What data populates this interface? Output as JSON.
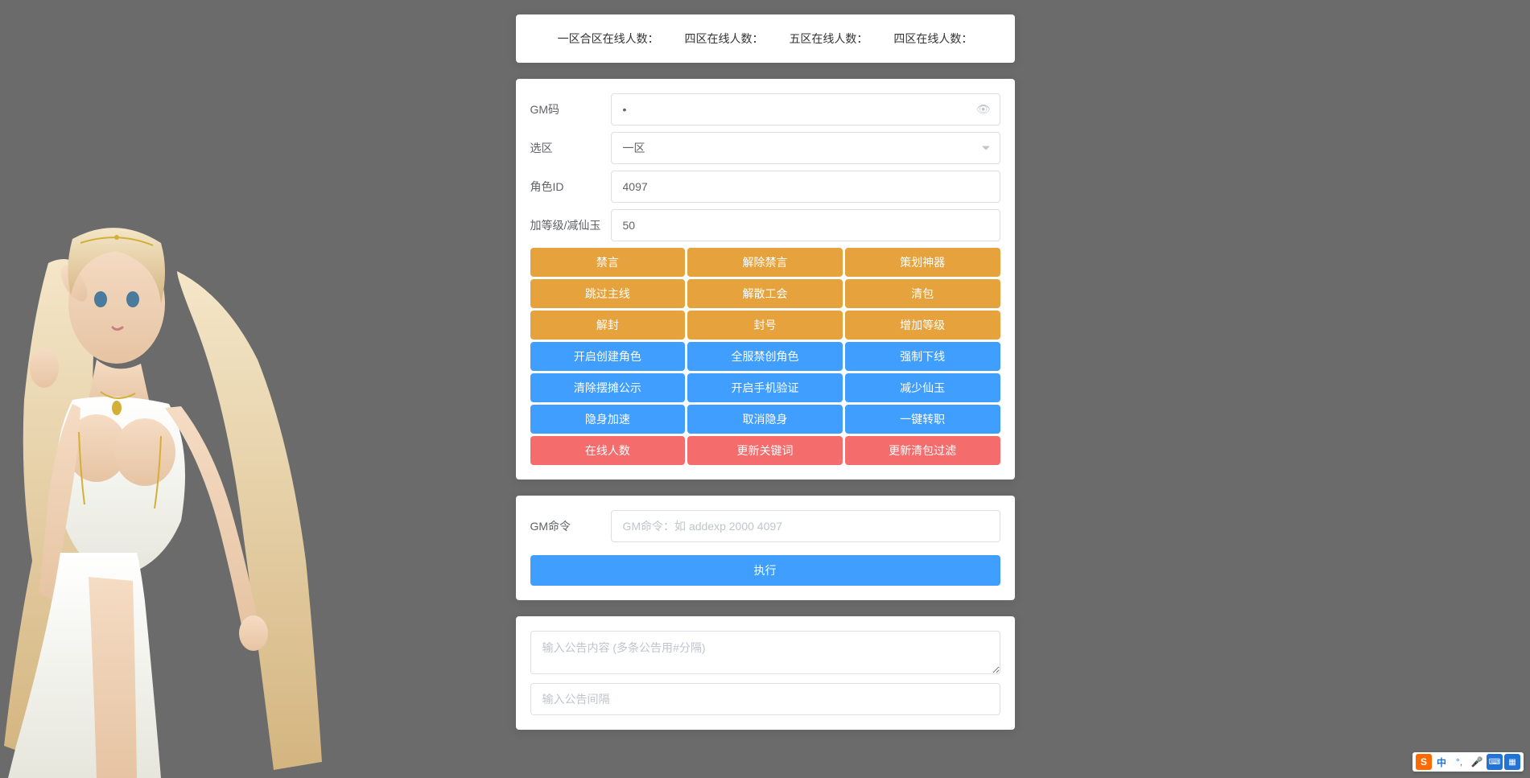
{
  "status": {
    "zone1": "一区合区在线人数：",
    "zone4a": "四区在线人数：",
    "zone5": "五区在线人数：",
    "zone4b": "四区在线人数："
  },
  "form": {
    "gmCode": {
      "label": "GM码",
      "value": "•"
    },
    "zone": {
      "label": "选区",
      "value": "一区"
    },
    "roleId": {
      "label": "角色ID",
      "value": "4097"
    },
    "levelJade": {
      "label": "加等级/减仙玉",
      "value": "50"
    }
  },
  "buttons": {
    "warning": [
      [
        "禁言",
        "解除禁言",
        "策划神器"
      ],
      [
        "跳过主线",
        "解散工会",
        "清包"
      ],
      [
        "解封",
        "封号",
        "增加等级"
      ]
    ],
    "primary": [
      [
        "开启创建角色",
        "全服禁创角色",
        "强制下线"
      ],
      [
        "清除摆摊公示",
        "开启手机验证",
        "减少仙玉"
      ],
      [
        "隐身加速",
        "取消隐身",
        "一键转职"
      ]
    ],
    "danger": [
      [
        "在线人数",
        "更新关键词",
        "更新清包过滤"
      ]
    ]
  },
  "gmCommand": {
    "label": "GM命令",
    "placeholder": "GM命令：如 addexp 2000 4097",
    "execute": "执行"
  },
  "announce": {
    "contentPlaceholder": "输入公告内容 (多条公告用#分隔)",
    "intervalPlaceholder": "输入公告间隔"
  },
  "ime": {
    "zh": "中"
  }
}
